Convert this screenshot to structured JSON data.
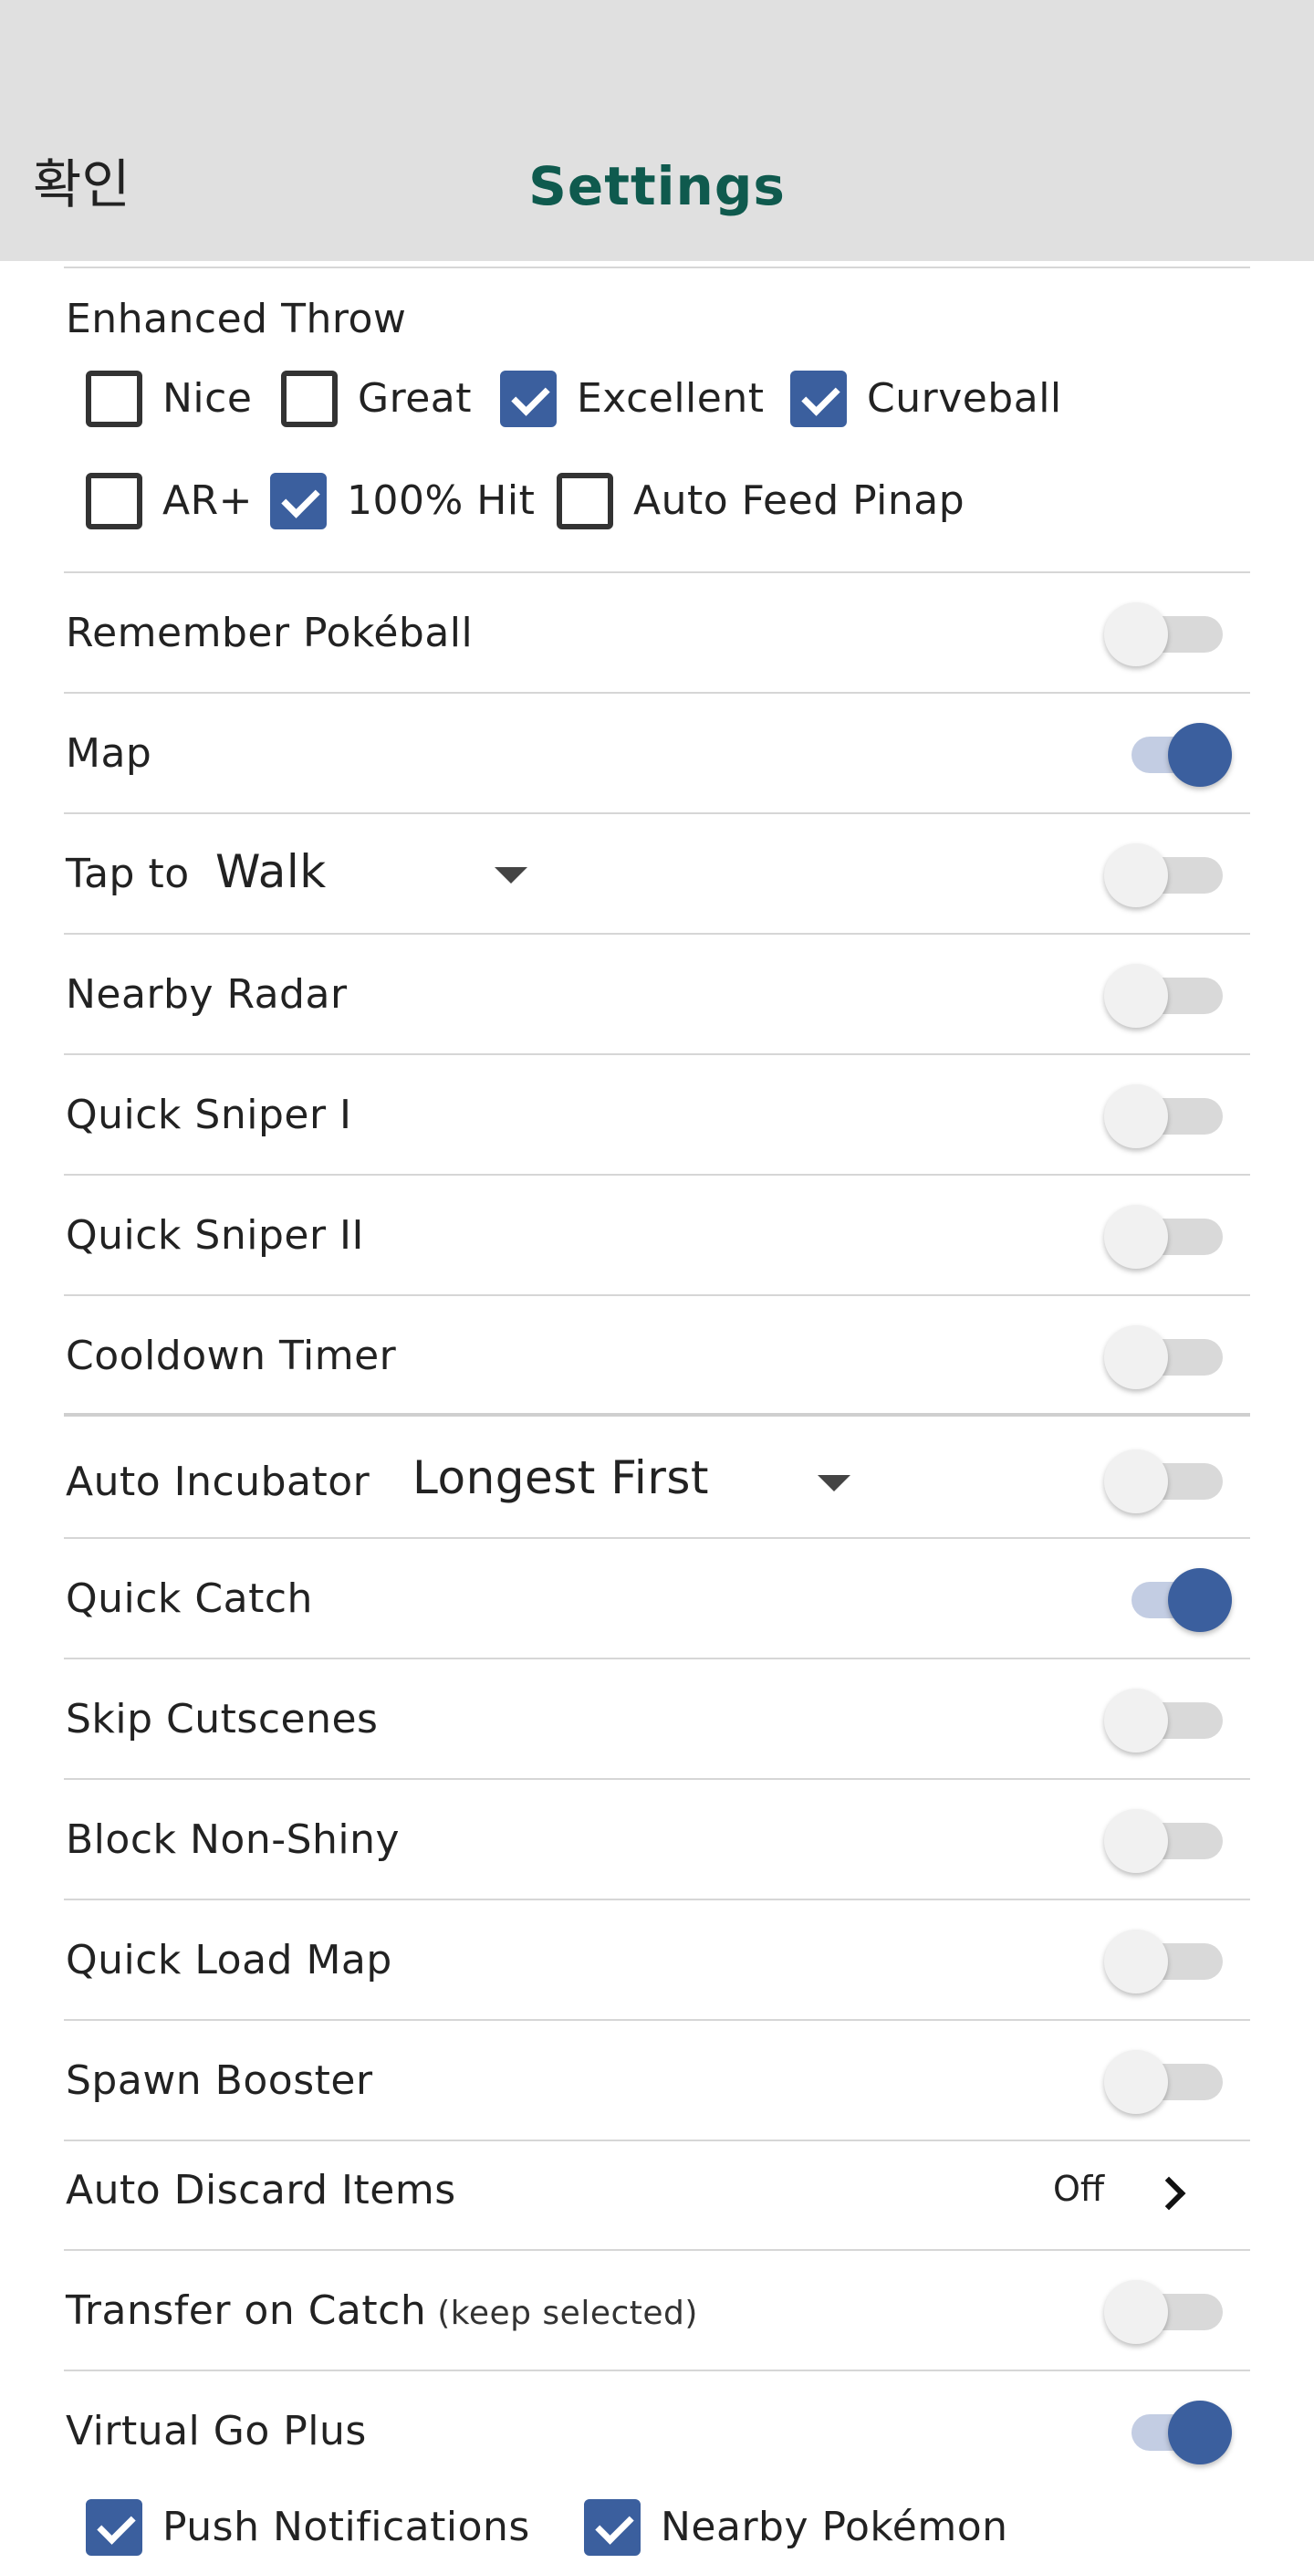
{
  "header": {
    "confirm_label": "확인",
    "title": "Settings"
  },
  "enhanced_throw": {
    "label": "Enhanced Throw",
    "options": [
      {
        "label": "Nice",
        "checked": false
      },
      {
        "label": "Great",
        "checked": false
      },
      {
        "label": "Excellent",
        "checked": true
      },
      {
        "label": "Curveball",
        "checked": true
      },
      {
        "label": "AR+",
        "checked": false
      },
      {
        "label": "100% Hit",
        "checked": true
      },
      {
        "label": "Auto Feed Pinap",
        "checked": false
      }
    ]
  },
  "settings": [
    {
      "label": "Remember Pokéball",
      "on": false
    },
    {
      "label": "Map",
      "on": true
    },
    {
      "label": "Tap to",
      "dropdown": "Walk",
      "on": false
    },
    {
      "label": "Nearby Radar",
      "on": false
    },
    {
      "label": "Quick Sniper I",
      "on": false
    },
    {
      "label": "Quick Sniper II",
      "on": false
    },
    {
      "label": "Cooldown Timer",
      "on": false
    },
    {
      "label": "Auto Incubator",
      "dropdown": "Longest First",
      "on": false
    },
    {
      "label": "Quick Catch",
      "on": true
    },
    {
      "label": "Skip Cutscenes",
      "on": false
    },
    {
      "label": "Block Non-Shiny",
      "on": false
    },
    {
      "label": "Quick Load Map",
      "on": false
    },
    {
      "label": "Spawn Booster",
      "on": false
    },
    {
      "label": "Auto Discard Items",
      "value": "Off"
    },
    {
      "label": "Transfer on Catch",
      "sublabel": "(keep selected)",
      "on": false
    },
    {
      "label": "Virtual Go Plus",
      "on": true
    }
  ],
  "go_plus_options": [
    {
      "label": "Push Notifications",
      "checked": true
    },
    {
      "label": "Nearby Pokémon",
      "checked": true
    }
  ],
  "colors": {
    "accent": "#3b5f9e",
    "title": "#0f5a4e",
    "header_bg": "#e0e0e0"
  }
}
